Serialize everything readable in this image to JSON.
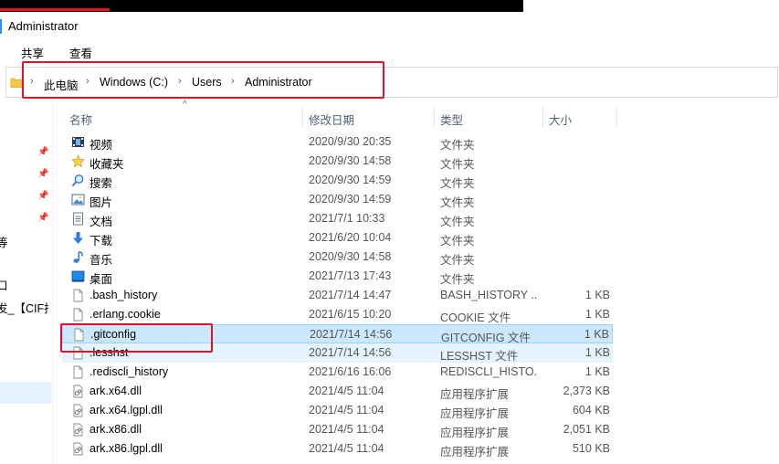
{
  "window": {
    "title": "Administrator"
  },
  "ribbon": {
    "tabs": [
      "共享",
      "查看"
    ]
  },
  "address": {
    "crumbs": [
      "此电脑",
      "Windows (C:)",
      "Users",
      "Administrator"
    ]
  },
  "columns": {
    "name": "名称",
    "date": "修改日期",
    "type": "类型",
    "size": "大小"
  },
  "nav": {
    "items": [
      "等",
      "口",
      "发_【CIF指"
    ]
  },
  "files": [
    {
      "name": "视频",
      "date": "2020/9/30 20:35",
      "type": "文件夹",
      "size": "",
      "icon": "video-folder-icon"
    },
    {
      "name": "收藏夹",
      "date": "2020/9/30 14:58",
      "type": "文件夹",
      "size": "",
      "icon": "favorites-star-icon"
    },
    {
      "name": "搜索",
      "date": "2020/9/30 14:59",
      "type": "文件夹",
      "size": "",
      "icon": "search-icon"
    },
    {
      "name": "图片",
      "date": "2020/9/30 14:59",
      "type": "文件夹",
      "size": "",
      "icon": "pictures-folder-icon"
    },
    {
      "name": "文档",
      "date": "2021/7/1 10:33",
      "type": "文件夹",
      "size": "",
      "icon": "documents-folder-icon"
    },
    {
      "name": "下载",
      "date": "2021/6/20 10:04",
      "type": "文件夹",
      "size": "",
      "icon": "download-arrow-icon"
    },
    {
      "name": "音乐",
      "date": "2020/9/30 14:58",
      "type": "文件夹",
      "size": "",
      "icon": "music-note-icon"
    },
    {
      "name": "桌面",
      "date": "2021/7/13 17:43",
      "type": "文件夹",
      "size": "",
      "icon": "desktop-folder-icon"
    },
    {
      "name": ".bash_history",
      "date": "2021/7/14 14:47",
      "type": "BASH_HISTORY ...",
      "size": "1 KB",
      "icon": "file-icon"
    },
    {
      "name": ".erlang.cookie",
      "date": "2021/6/15 10:20",
      "type": "COOKIE 文件",
      "size": "1 KB",
      "icon": "file-icon"
    },
    {
      "name": ".gitconfig",
      "date": "2021/7/14 14:56",
      "type": "GITCONFIG 文件",
      "size": "1 KB",
      "icon": "file-icon"
    },
    {
      "name": ".lesshst",
      "date": "2021/7/14 14:56",
      "type": "LESSHST 文件",
      "size": "1 KB",
      "icon": "file-icon"
    },
    {
      "name": ".rediscli_history",
      "date": "2021/6/16 16:06",
      "type": "REDISCLI_HISTO...",
      "size": "1 KB",
      "icon": "file-icon"
    },
    {
      "name": "ark.x64.dll",
      "date": "2021/4/5 11:04",
      "type": "应用程序扩展",
      "size": "2,373 KB",
      "icon": "dll-file-icon"
    },
    {
      "name": "ark.x64.lgpl.dll",
      "date": "2021/4/5 11:04",
      "type": "应用程序扩展",
      "size": "604 KB",
      "icon": "dll-file-icon"
    },
    {
      "name": "ark.x86.dll",
      "date": "2021/4/5 11:04",
      "type": "应用程序扩展",
      "size": "2,051 KB",
      "icon": "dll-file-icon"
    },
    {
      "name": "ark.x86.lgpl.dll",
      "date": "2021/4/5 11:04",
      "type": "应用程序扩展",
      "size": "510 KB",
      "icon": "dll-file-icon"
    }
  ],
  "colors": {
    "highlight": "#e81123",
    "selection": "#cce8ff",
    "hover": "#e5f3ff"
  }
}
